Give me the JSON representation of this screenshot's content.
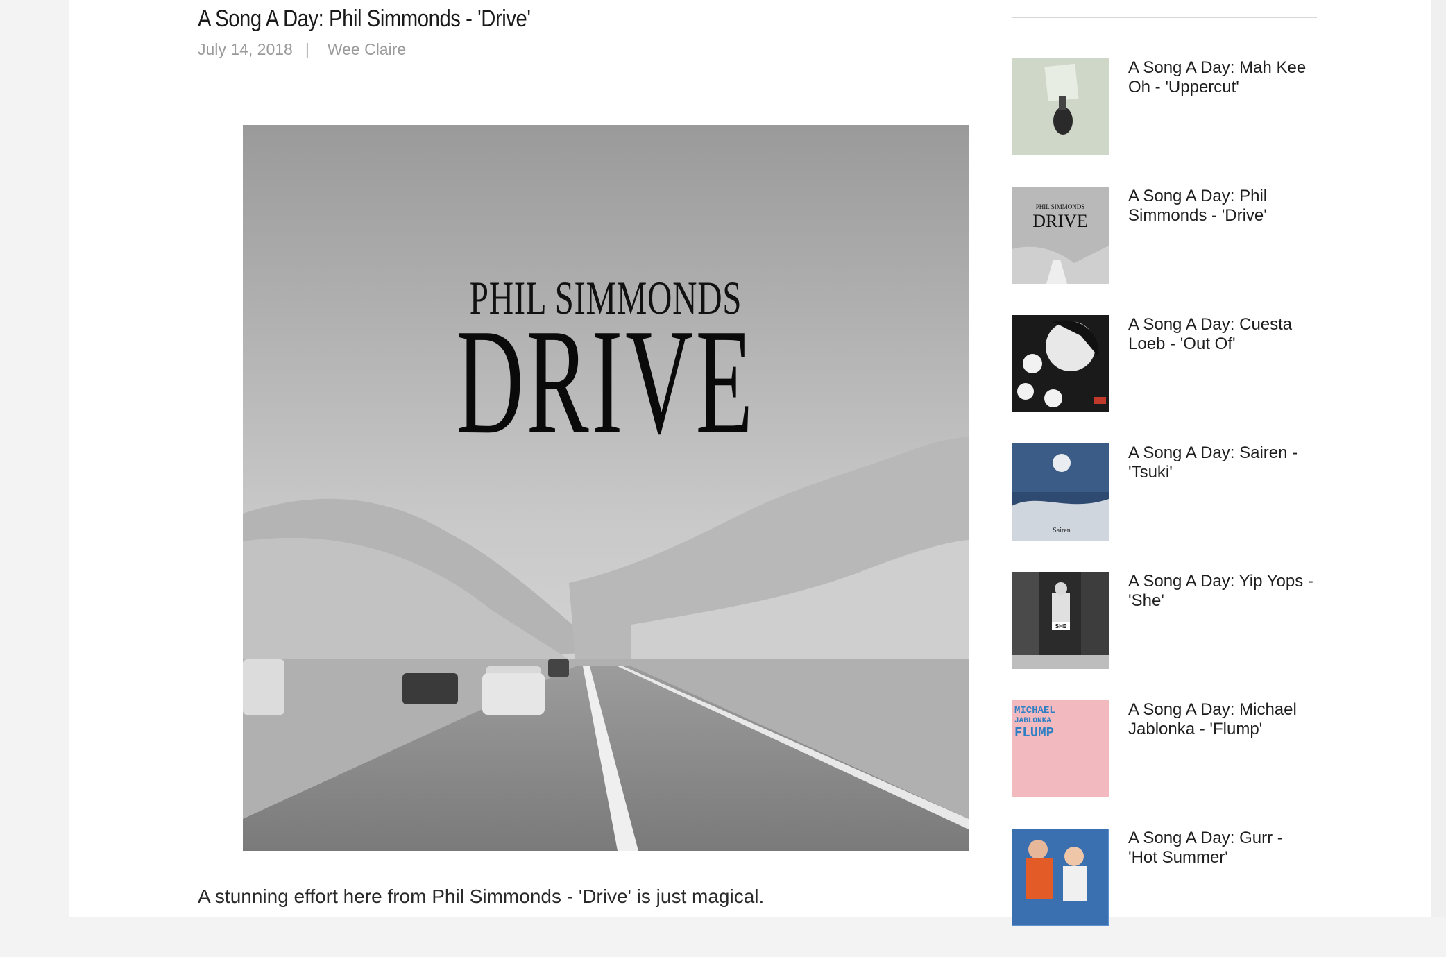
{
  "post": {
    "title": "A Song A Day: Phil Simmonds - 'Drive'",
    "date": "July 14, 2018",
    "separator": "|",
    "author": "Wee Claire",
    "cover": {
      "artist": "PHIL SIMMONDS",
      "title": "DRIVE"
    },
    "body": "A stunning effort here from Phil Simmonds - 'Drive' is just magical."
  },
  "sidebar": {
    "related": [
      {
        "line1": "A Song A Day: Mah Kee",
        "line2": "Oh - 'Uppercut'"
      },
      {
        "line1": "A Song A Day: Phil",
        "line2": "Simmonds - 'Drive'"
      },
      {
        "line1": "A Song A Day: Cuesta",
        "line2": "Loeb - 'Out Of'"
      },
      {
        "line1": "A Song A Day: Sairen -",
        "line2": "'Tsuki'"
      },
      {
        "line1": "A Song A Day: Yip Yops -",
        "line2": "'She'"
      },
      {
        "line1": "A Song A Day: Michael",
        "line2": "Jablonka - 'Flump'"
      },
      {
        "line1": "A Song A Day: Gurr -",
        "line2": "'Hot Summer'"
      }
    ],
    "thumb_text": {
      "drive_artist": "PHIL SIMMONDS",
      "drive_title": "DRIVE",
      "sairen": "Sairen",
      "yipyops": "SHE",
      "jablonka1": "MICHAEL",
      "jablonka2": "JABLONKA",
      "jablonka3": "FLUMP"
    }
  }
}
